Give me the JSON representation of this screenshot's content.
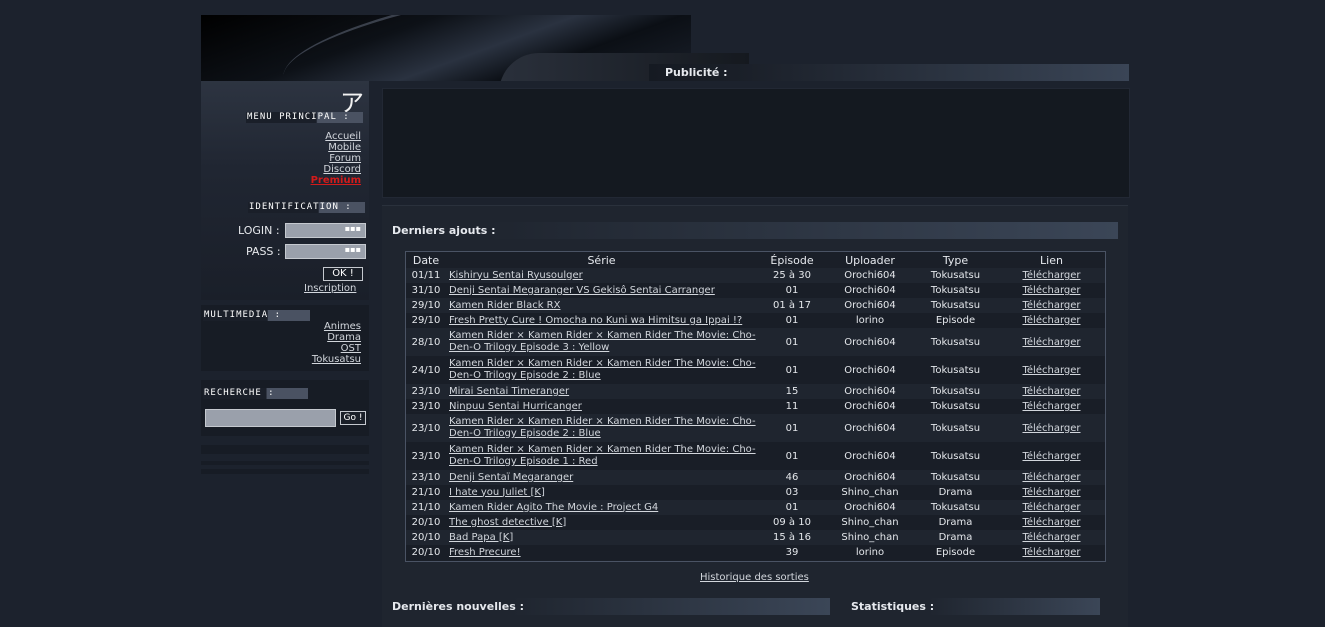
{
  "header": {
    "publicite_label": "Publicité :",
    "logo_glyph": "ア"
  },
  "sidebar": {
    "menu_title": "MENU PRINCIPAL :",
    "menu_items": [
      "Accueil",
      "Mobile",
      "Forum",
      "Discord",
      "Premium"
    ],
    "identification_title": "IDENTIFICATION :",
    "login_label": "LOGIN :",
    "pass_label": "PASS :",
    "ok_label": "OK !",
    "inscription_label": "Inscription",
    "multimedia_title": "MULTIMEDIA :",
    "multimedia_items": [
      "Animes",
      "Drama",
      "OST",
      "Tokusatsu"
    ],
    "search_title": "RECHERCHE :",
    "search_button": "Go !"
  },
  "main": {
    "latest_title": "Derniers ajouts :",
    "columns": [
      "Date",
      "Série",
      "Épisode",
      "Uploader",
      "Type",
      "Lien"
    ],
    "rows": [
      {
        "date": "01/11",
        "serie": "Kishiryu Sentai Ryusoulger",
        "ep": "25 à 30",
        "up": "Orochi604",
        "type": "Tokusatsu",
        "lien": "Télécharger"
      },
      {
        "date": "31/10",
        "serie": "Denji Sentai Megaranger VS Gekisô Sentai Carranger",
        "ep": "01",
        "up": "Orochi604",
        "type": "Tokusatsu",
        "lien": "Télécharger"
      },
      {
        "date": "29/10",
        "serie": "Kamen Rider Black RX",
        "ep": "01 à 17",
        "up": "Orochi604",
        "type": "Tokusatsu",
        "lien": "Télécharger"
      },
      {
        "date": "29/10",
        "serie": "Fresh Pretty Cure ! Omocha no Kuni wa Himitsu ga Ippai !?",
        "ep": "01",
        "up": "lorino",
        "type": "Episode",
        "lien": "Télécharger"
      },
      {
        "date": "28/10",
        "serie": "Kamen Rider × Kamen Rider × Kamen Rider The Movie: Cho-Den-O Trilogy Episode 3 : Yellow",
        "ep": "01",
        "up": "Orochi604",
        "type": "Tokusatsu",
        "lien": "Télécharger"
      },
      {
        "date": "24/10",
        "serie": "Kamen Rider × Kamen Rider × Kamen Rider The Movie: Cho-Den-O Trilogy Episode 2 : Blue",
        "ep": "01",
        "up": "Orochi604",
        "type": "Tokusatsu",
        "lien": "Télécharger"
      },
      {
        "date": "23/10",
        "serie": "Mirai Sentai Timeranger",
        "ep": "15",
        "up": "Orochi604",
        "type": "Tokusatsu",
        "lien": "Télécharger"
      },
      {
        "date": "23/10",
        "serie": "Ninpuu Sentai Hurricanger",
        "ep": "11",
        "up": "Orochi604",
        "type": "Tokusatsu",
        "lien": "Télécharger"
      },
      {
        "date": "23/10",
        "serie": "Kamen Rider × Kamen Rider × Kamen Rider The Movie: Cho-Den-O Trilogy Episode 2 : Blue",
        "ep": "01",
        "up": "Orochi604",
        "type": "Tokusatsu",
        "lien": "Télécharger"
      },
      {
        "date": "23/10",
        "serie": "Kamen Rider × Kamen Rider × Kamen Rider The Movie: Cho-Den-O Trilogy Episode 1 : Red",
        "ep": "01",
        "up": "Orochi604",
        "type": "Tokusatsu",
        "lien": "Télécharger"
      },
      {
        "date": "23/10",
        "serie": "Denji Sentaï Megaranger",
        "ep": "46",
        "up": "Orochi604",
        "type": "Tokusatsu",
        "lien": "Télécharger"
      },
      {
        "date": "21/10",
        "serie": "I hate you Juliet [K]",
        "ep": "03",
        "up": "Shino_chan",
        "type": "Drama",
        "lien": "Télécharger"
      },
      {
        "date": "21/10",
        "serie": "Kamen Rider Agito The Movie : Project G4",
        "ep": "01",
        "up": "Orochi604",
        "type": "Tokusatsu",
        "lien": "Télécharger"
      },
      {
        "date": "20/10",
        "serie": "The ghost detective [K]",
        "ep": "09 à 10",
        "up": "Shino_chan",
        "type": "Drama",
        "lien": "Télécharger"
      },
      {
        "date": "20/10",
        "serie": "Bad Papa [K]",
        "ep": "15 à 16",
        "up": "Shino_chan",
        "type": "Drama",
        "lien": "Télécharger"
      },
      {
        "date": "20/10",
        "serie": "Fresh Precure!",
        "ep": "39",
        "up": "lorino",
        "type": "Episode",
        "lien": "Télécharger"
      }
    ],
    "history_link": "Historique des sorties",
    "news_title": "Dernières nouvelles :",
    "stats_title": "Statistiques :"
  }
}
